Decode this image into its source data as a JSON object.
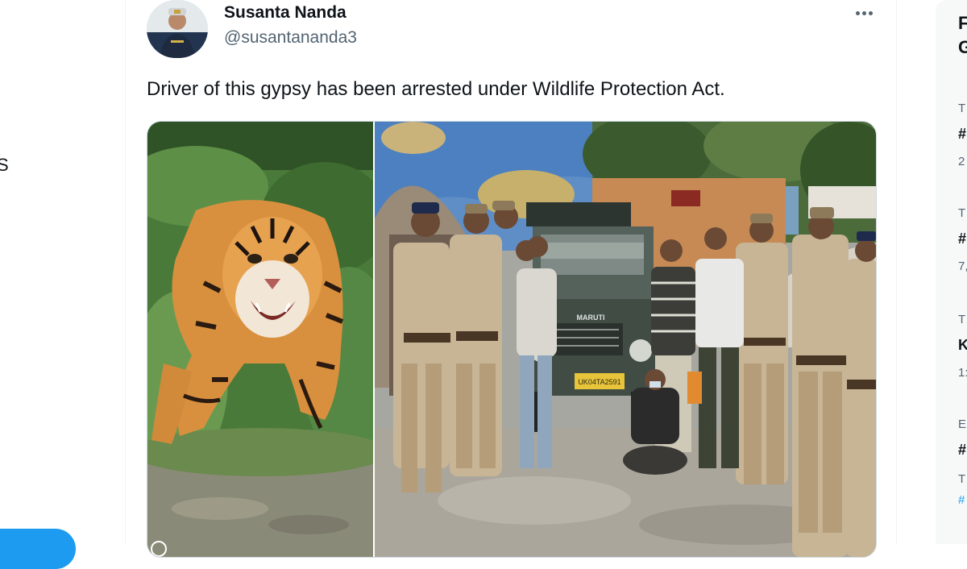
{
  "nav": {
    "fragment_label": "S"
  },
  "tweet": {
    "author_name": "Susanta Nanda",
    "author_handle": "@susantananda3",
    "text": "Driver of this gypsy has been arrested under Wildlife Protection Act.",
    "more_icon": "more-horizontal-icon",
    "jeep_brand": "MARUTI",
    "jeep_plate": "UK04TA2591"
  },
  "sidebar": {
    "title_line1": "F",
    "title_line2": "G",
    "trends": [
      {
        "context": "T",
        "name": "#",
        "count": "2"
      },
      {
        "context": "T",
        "name": "#",
        "count": "7,"
      },
      {
        "context": "T",
        "name": "K",
        "count": "1:"
      },
      {
        "context": "E",
        "name": "#",
        "count": "T",
        "link": "#"
      }
    ]
  },
  "colors": {
    "accent": "#1d9bf0",
    "text_primary": "#0f1419",
    "text_secondary": "#536471"
  }
}
